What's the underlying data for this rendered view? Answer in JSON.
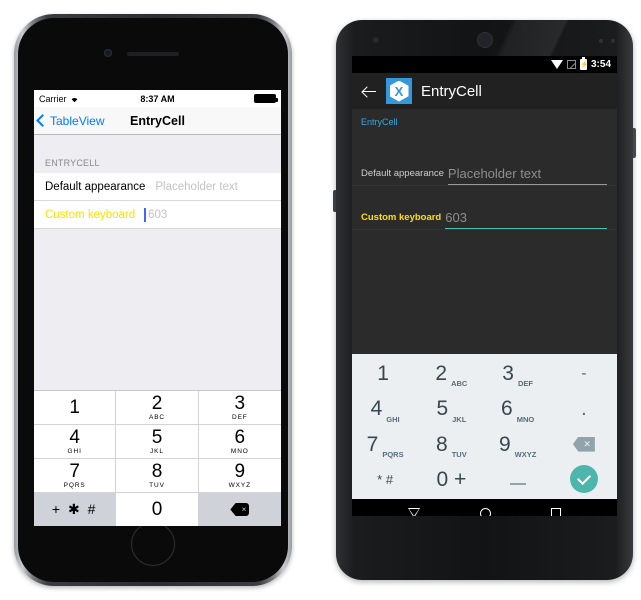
{
  "ios": {
    "status": {
      "carrier": "Carrier",
      "wifi_icon": "wifi-icon",
      "time": "8:37 AM",
      "battery_icon": "battery-full-icon"
    },
    "nav": {
      "back_label": "TableView",
      "back_icon": "chevron-left-icon",
      "title": "EntryCell"
    },
    "section_header": "ENTRYCELL",
    "cells": [
      {
        "label": "Default appearance",
        "value": "Placeholder text",
        "label_color": "#000000"
      },
      {
        "label": "Custom keyboard",
        "value": "603",
        "label_color": "#ffe000"
      }
    ],
    "keypad": [
      {
        "digit": "1",
        "letters": ""
      },
      {
        "digit": "2",
        "letters": "ABC"
      },
      {
        "digit": "3",
        "letters": "DEF"
      },
      {
        "digit": "4",
        "letters": "GHI"
      },
      {
        "digit": "5",
        "letters": "JKL"
      },
      {
        "digit": "6",
        "letters": "MNO"
      },
      {
        "digit": "7",
        "letters": "PQRS"
      },
      {
        "digit": "8",
        "letters": "TUV"
      },
      {
        "digit": "9",
        "letters": "WXYZ"
      },
      {
        "digit": "+ ✱ #",
        "letters": ""
      },
      {
        "digit": "0",
        "letters": ""
      },
      {
        "digit": "delete-icon",
        "letters": ""
      }
    ]
  },
  "android": {
    "status": {
      "wifi_icon": "wifi-icon",
      "signal_icon": "no-signal-icon",
      "battery_icon": "battery-charging-icon",
      "time": "3:54"
    },
    "actionbar": {
      "back_icon": "arrow-left-icon",
      "app_icon": "xamarin-logo-icon",
      "app_icon_letter": "X",
      "title": "EntryCell"
    },
    "section_header": "EntryCell",
    "rows": [
      {
        "label": "Default appearance",
        "value": "Placeholder text",
        "label_color": "#cfcfcf",
        "underline_color": "#9a9a9a"
      },
      {
        "label": "Custom keyboard",
        "value": "603",
        "label_color": "#ffe000",
        "underline_color": "#45c2b1"
      }
    ],
    "keypad": [
      {
        "digit": "1",
        "letters": ""
      },
      {
        "digit": "2",
        "letters": "ABC"
      },
      {
        "digit": "3",
        "letters": "DEF"
      },
      {
        "digit": "-",
        "letters": ""
      },
      {
        "digit": "4",
        "letters": "GHI"
      },
      {
        "digit": "5",
        "letters": "JKL"
      },
      {
        "digit": "6",
        "letters": "MNO"
      },
      {
        "digit": ".",
        "letters": ""
      },
      {
        "digit": "7",
        "letters": "PQRS"
      },
      {
        "digit": "8",
        "letters": "TUV"
      },
      {
        "digit": "9",
        "letters": "WXYZ"
      },
      {
        "digit": "delete-icon",
        "letters": ""
      },
      {
        "digit": "* #",
        "letters": ""
      },
      {
        "digit": "0 +",
        "letters": ""
      },
      {
        "digit": "_",
        "letters": ""
      },
      {
        "digit": "ok-icon",
        "letters": ""
      }
    ],
    "navbar": {
      "back_icon": "nav-back-triangle-icon",
      "home_icon": "nav-home-circle-icon",
      "recents_icon": "nav-recents-square-icon"
    }
  },
  "colors": {
    "ios_accent": "#007aff",
    "android_accent": "#3aa7e0",
    "highlight_yellow": "#ffe000",
    "teal": "#45c2b1",
    "xamarin_blue": "#3498db"
  }
}
